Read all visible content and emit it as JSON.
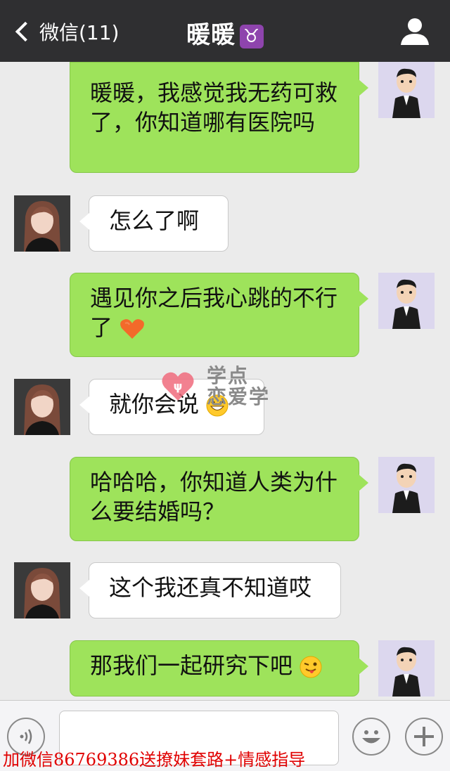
{
  "header": {
    "back_label": "微信(11)",
    "title": "暖暖",
    "title_badge": "♉"
  },
  "messages": [
    {
      "side": "right",
      "text_lines": [
        "暖暖，我感觉我无药可救",
        "了，你知道哪有医院吗"
      ]
    },
    {
      "side": "left",
      "text": "怎么了啊"
    },
    {
      "side": "right",
      "text_lines": [
        "遇见你之后我心跳的不行",
        "了"
      ],
      "emoji": "heart"
    },
    {
      "side": "left",
      "text": "就你会说",
      "emoji": "grin"
    },
    {
      "side": "right",
      "text_lines": [
        "哈哈哈，你知道人类为什",
        "么要结婚吗？"
      ]
    },
    {
      "side": "left",
      "text": "这个我还真不知道哎"
    },
    {
      "side": "right",
      "text": "那我们一起研究下吧",
      "emoji": "wink-tongue"
    }
  ],
  "watermark": {
    "line1": "学点",
    "line2": "恋爱学"
  },
  "promo": "加微信86769386送撩妹套路+情感指导",
  "colors": {
    "nav_bg": "#2f2f31",
    "sent_bubble": "#9ee35b",
    "received_bubble": "#ffffff",
    "promo_red": "#e00000"
  }
}
